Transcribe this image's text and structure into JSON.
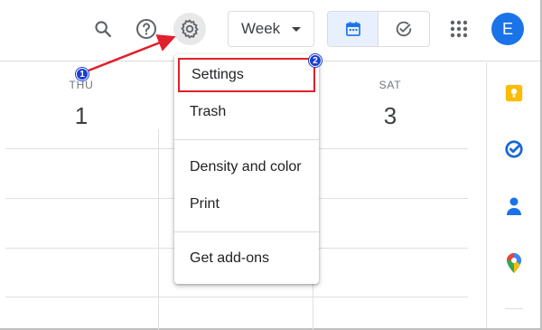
{
  "toolbar": {
    "search_icon": "search-icon",
    "help_icon": "help-icon",
    "settings_icon": "gear-icon",
    "view_select": "Week",
    "calendar_view_icon": "calendar-icon",
    "tasks_view_icon": "task-check-icon",
    "apps_icon": "apps-grid-icon",
    "avatar_initial": "E"
  },
  "calendar": {
    "days": [
      {
        "name": "THU",
        "number": "1"
      },
      {
        "name": "SAT",
        "number": "3"
      }
    ]
  },
  "settings_menu": {
    "items": [
      {
        "label": "Settings"
      },
      {
        "label": "Trash"
      },
      {
        "label": "Density and color"
      },
      {
        "label": "Print"
      },
      {
        "label": "Get add-ons"
      }
    ]
  },
  "side_panel": {
    "icons": [
      "keep-icon",
      "tasks-icon",
      "contacts-icon",
      "maps-icon"
    ]
  },
  "annotations": {
    "step1": "1",
    "step2": "2",
    "highlight_color": "#e0202a",
    "badge_color": "#1a3fd1"
  },
  "colors": {
    "accent": "#1a73e8",
    "selected_segment": "#e8f0fe"
  }
}
